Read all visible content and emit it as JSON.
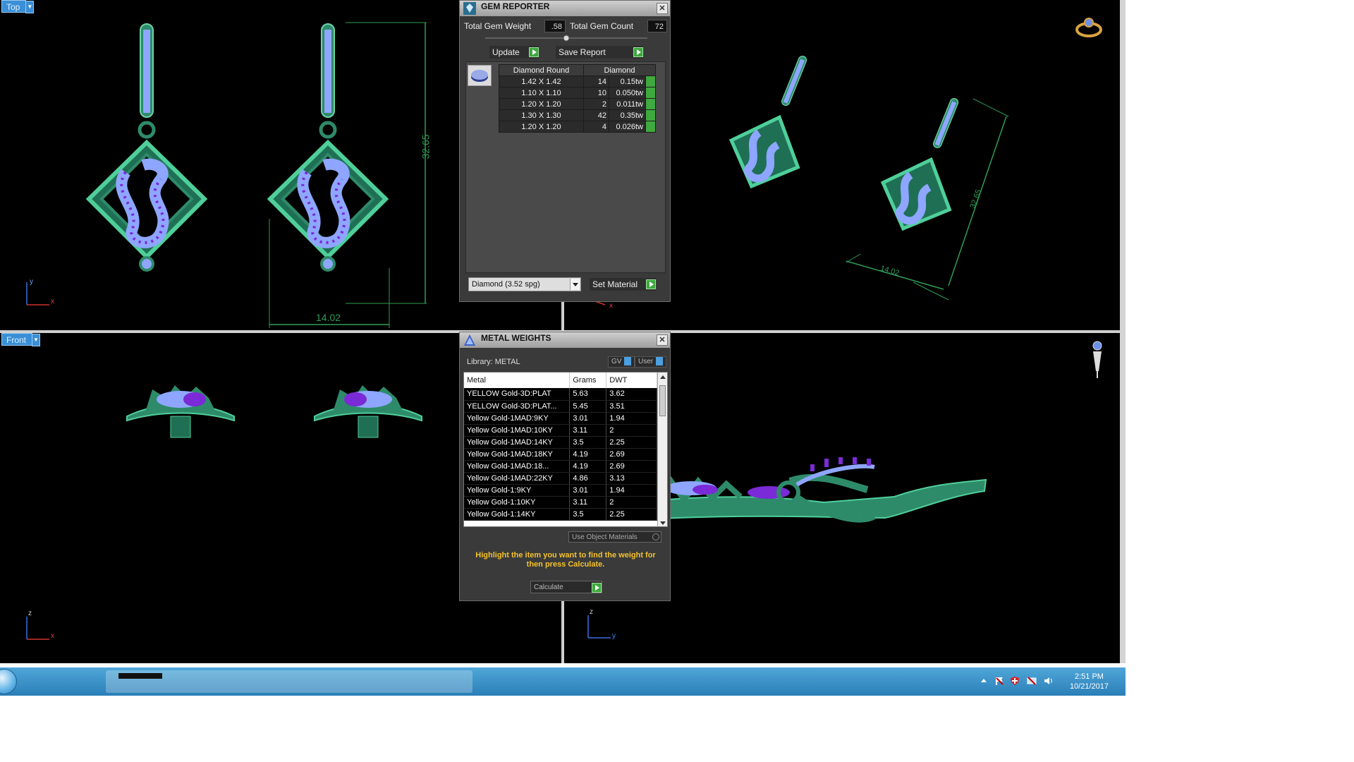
{
  "viewports": {
    "top": {
      "label": "Top",
      "axis_x": "x",
      "axis_y": "y",
      "dim_height": "32.65",
      "dim_width": "14.02"
    },
    "perspective": {
      "dim_height": "32.65",
      "dim_width": "14.02",
      "axis_x": "x"
    },
    "front": {
      "label": "Front",
      "axis_x": "x",
      "axis_z": "z"
    },
    "side": {
      "axis_y": "y",
      "axis_z": "z"
    }
  },
  "gem_reporter": {
    "title": "GEM REPORTER",
    "total_weight_label": "Total Gem Weight",
    "total_weight_value": ".58",
    "total_count_label": "Total Gem Count",
    "total_count_value": "72",
    "update_label": "Update",
    "save_report_label": "Save Report",
    "columns": [
      "Diamond Round",
      "Diamond"
    ],
    "rows": [
      {
        "size": "1.42 X 1.42",
        "count": "14",
        "weight": "0.15tw"
      },
      {
        "size": "1.10 X 1.10",
        "count": "10",
        "weight": "0.050tw"
      },
      {
        "size": "1.20 X 1.20",
        "count": "2",
        "weight": "0.011tw"
      },
      {
        "size": "1.30 X 1.30",
        "count": "42",
        "weight": "0.35tw"
      },
      {
        "size": "1.20 X 1.20",
        "count": "4",
        "weight": "0.026tw"
      }
    ],
    "material_select": "Diamond     (3.52 spg)",
    "set_material_label": "Set Material"
  },
  "metal_weights": {
    "title": "METAL WEIGHTS",
    "library_label": "Library: METAL",
    "gv_label": "GV",
    "user_label": "User",
    "columns": [
      "Metal",
      "Grams",
      "DWT"
    ],
    "rows": [
      {
        "metal": "YELLOW Gold-3D:PLAT",
        "grams": "5.63",
        "dwt": "3.62"
      },
      {
        "metal": "YELLOW Gold-3D:PLAT...",
        "grams": "5.45",
        "dwt": "3.51"
      },
      {
        "metal": "Yellow Gold-1MAD:9KY",
        "grams": "3.01",
        "dwt": "1.94"
      },
      {
        "metal": "Yellow Gold-1MAD:10KY",
        "grams": "3.11",
        "dwt": "2"
      },
      {
        "metal": "Yellow Gold-1MAD:14KY",
        "grams": "3.5",
        "dwt": "2.25"
      },
      {
        "metal": "Yellow Gold-1MAD:18KY",
        "grams": "4.19",
        "dwt": "2.69"
      },
      {
        "metal": "Yellow Gold-1MAD:18...",
        "grams": "4.19",
        "dwt": "2.69"
      },
      {
        "metal": "Yellow Gold-1MAD:22KY",
        "grams": "4.86",
        "dwt": "3.13"
      },
      {
        "metal": "Yellow Gold-1:9KY",
        "grams": "3.01",
        "dwt": "1.94"
      },
      {
        "metal": "Yellow Gold-1:10KY",
        "grams": "3.11",
        "dwt": "2"
      },
      {
        "metal": "Yellow Gold-1:14KY",
        "grams": "3.5",
        "dwt": "2.25"
      }
    ],
    "use_object_materials_label": "Use Object Materials",
    "hint": "Highlight the item you want to find the weight for then press Calculate.",
    "calculate_label": "Calculate"
  },
  "taskbar": {
    "time": "2:51 PM",
    "date": "10/21/2017"
  },
  "colors": {
    "metal": "#2e8b6a",
    "gem_light": "#8ea6ff",
    "gem_dark": "#7a2ad6",
    "dimension": "#2f9c55"
  }
}
